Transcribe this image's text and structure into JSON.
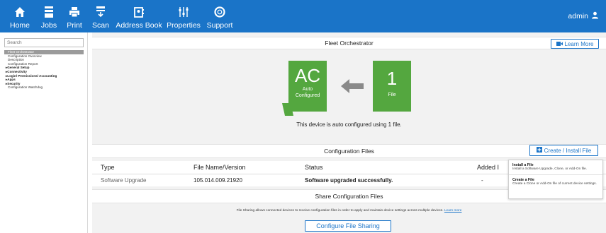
{
  "topbar": {
    "nav": [
      {
        "label": "Home",
        "icon": "home-icon"
      },
      {
        "label": "Jobs",
        "icon": "jobs-icon"
      },
      {
        "label": "Print",
        "icon": "print-icon"
      },
      {
        "label": "Scan",
        "icon": "scan-icon"
      },
      {
        "label": "Address Book",
        "icon": "address-book-icon"
      },
      {
        "label": "Properties",
        "icon": "properties-icon"
      },
      {
        "label": "Support",
        "icon": "support-icon"
      }
    ],
    "user": "admin",
    "user_icon": "user-icon",
    "bar_color": "#1a74c8"
  },
  "sidebar": {
    "search_placeholder": "Search",
    "items": [
      {
        "label": "Fleet Orchestrator"
      },
      {
        "label": "Configuration Overview"
      },
      {
        "label": "Description"
      },
      {
        "label": "Configuration Report"
      },
      {
        "label": "▸General Setup"
      },
      {
        "label": "▸Connectivity"
      },
      {
        "label": "▸Login/ Permissions/ Accounting"
      },
      {
        "label": "▸Apps"
      },
      {
        "label": "▸Security"
      },
      {
        "label": "Configuration Watchdog"
      }
    ]
  },
  "main": {
    "title": "Fleet Orchestrator",
    "learn_more": "Learn More",
    "tile_ac": {
      "big": "AC",
      "line1": "Auto",
      "line2": "Configured"
    },
    "tile_file": {
      "big": "1",
      "line1": "File"
    },
    "status_message": "This device is auto configured using 1 file.",
    "config_files_title": "Configuration Files",
    "create_install_button": "Create / Install File",
    "table": {
      "headers": [
        "Type",
        "File Name/Version",
        "Status",
        "Added I"
      ],
      "rows": [
        {
          "type": "Software Upgrade",
          "file": "105.014.009.21920",
          "status": "Software upgraded successfully.",
          "added": "-"
        }
      ]
    },
    "share_title": "Share Configuration Files",
    "share_text": "File Sharing allows connected devices to receive configuration files in order to apply and maintain device settings across multiple devices.",
    "share_link": "Learn more",
    "configure_sharing_button": "Configure File Sharing",
    "accent_green": "#54a73f"
  },
  "popup": {
    "items": [
      {
        "title": "Install a File",
        "desc": "Install a Software Upgrade, Clone, or Add-On file."
      },
      {
        "title": "Create a File",
        "desc": "Create a Clone or Add-On file of current device settings."
      }
    ]
  }
}
